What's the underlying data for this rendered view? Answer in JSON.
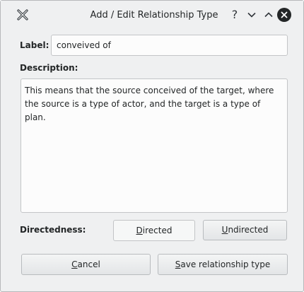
{
  "window": {
    "title": "Add / Edit Relationship Type",
    "help_glyph": "?"
  },
  "form": {
    "label_caption": "Label:",
    "label_value": "conveived of",
    "description_caption": "Description:",
    "description_value": "This means that the source conceived of the target, where the source is a type of actor, and the target is a type of plan.",
    "directedness_caption": "Directedness:"
  },
  "buttons": {
    "directed": {
      "mnemonic": "D",
      "rest": "irected"
    },
    "undirected": {
      "mnemonic": "U",
      "rest": "ndirected"
    },
    "cancel": {
      "mnemonic": "C",
      "rest": "ancel"
    },
    "save": {
      "mnemonic": "S",
      "rest": "ave relationship type"
    }
  },
  "icons": {
    "app": "app-x-icon",
    "help": "help-icon",
    "minimize": "chevron-down-icon",
    "maximize": "chevron-up-icon",
    "close": "close-icon"
  },
  "colors": {
    "window_bg": "#eff0f1",
    "field_bg": "#fcfcfc",
    "text": "#232627"
  }
}
